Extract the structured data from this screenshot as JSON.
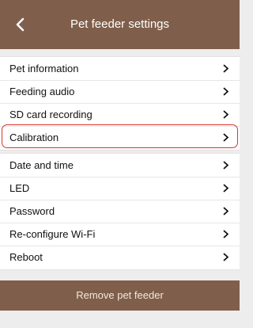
{
  "header": {
    "title": "Pet feeder settings",
    "back_icon": "chevron-left-icon"
  },
  "menu": {
    "group1": [
      {
        "label": "Pet information",
        "name": "menu-item-pet-information"
      },
      {
        "label": "Feeding audio",
        "name": "menu-item-feeding-audio"
      },
      {
        "label": "SD card recording",
        "name": "menu-item-sd-card-recording"
      },
      {
        "label": "Calibration",
        "name": "menu-item-calibration",
        "highlighted": true
      }
    ],
    "group2": [
      {
        "label": "Date and time",
        "name": "menu-item-date-and-time"
      },
      {
        "label": "LED",
        "name": "menu-item-led"
      },
      {
        "label": "Password",
        "name": "menu-item-password"
      },
      {
        "label": "Re-configure Wi-Fi",
        "name": "menu-item-reconfigure-wifi"
      },
      {
        "label": "Reboot",
        "name": "menu-item-reboot"
      }
    ]
  },
  "footer": {
    "remove_label": "Remove pet feeder"
  },
  "colors": {
    "brand": "#7f5f4b",
    "highlight": "#d9342a",
    "background": "#ededed"
  }
}
